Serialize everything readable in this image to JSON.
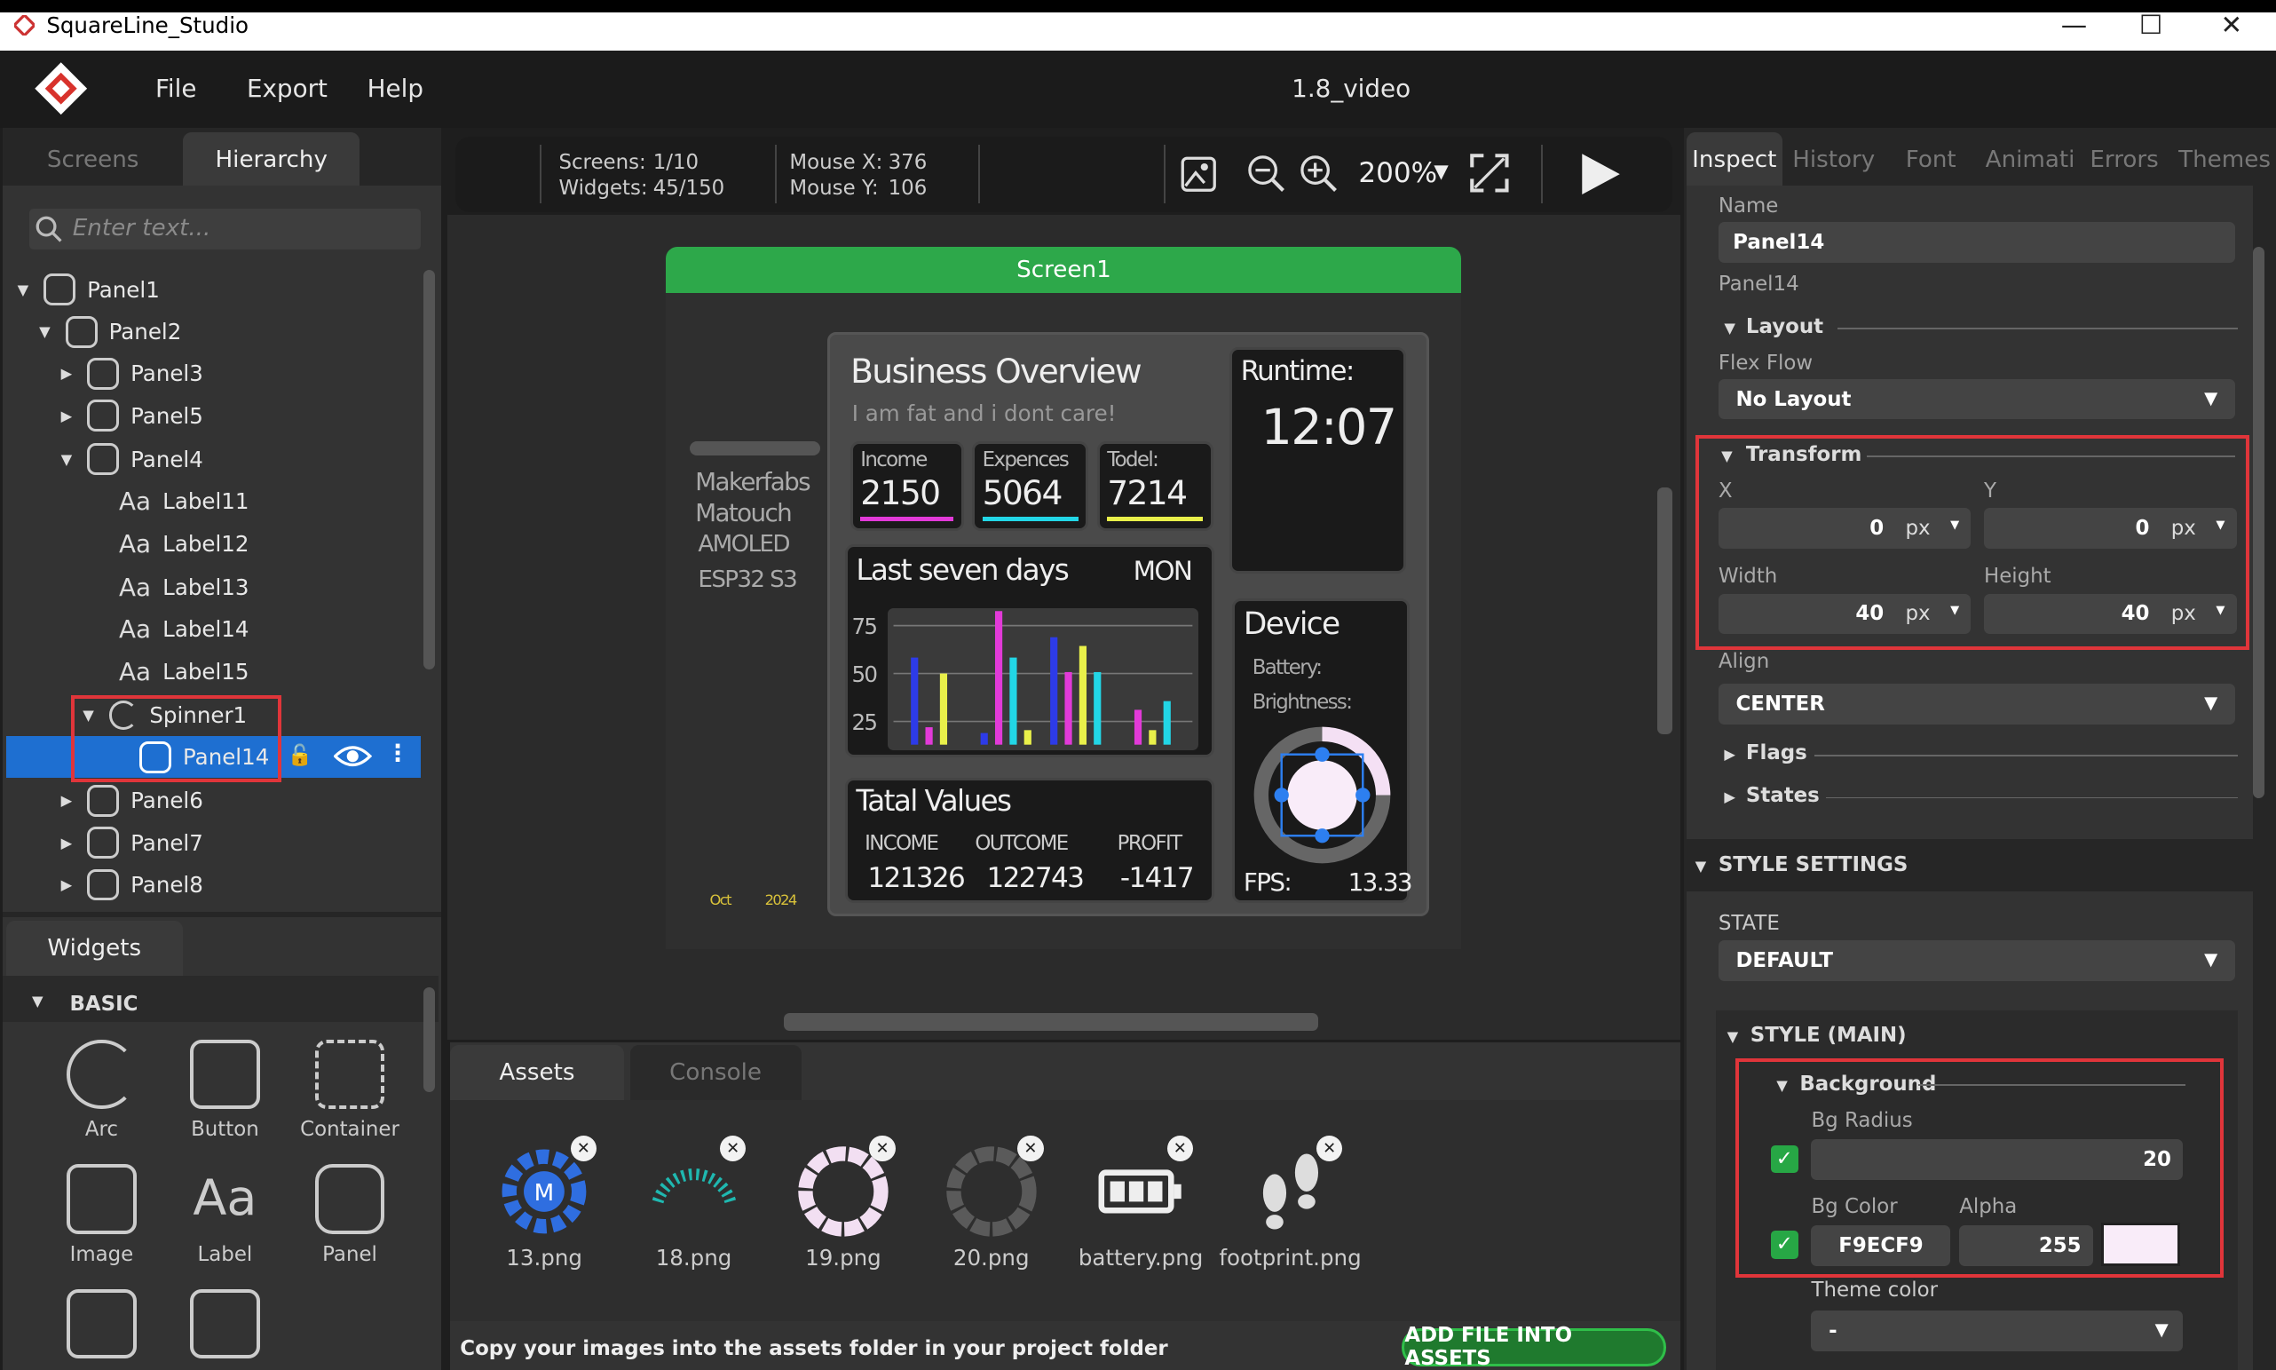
{
  "window": {
    "title": "SquareLine_Studio",
    "minimize": "—",
    "maximize": "☐",
    "close": "✕"
  },
  "menu": {
    "file": "File",
    "export": "Export",
    "help": "Help",
    "project": "1.8_video"
  },
  "left_tabs": {
    "screens": "Screens",
    "hierarchy": "Hierarchy"
  },
  "search": {
    "placeholder": "Enter text..."
  },
  "tree": [
    {
      "label": "Panel1"
    },
    {
      "label": "Panel2"
    },
    {
      "label": "Panel3"
    },
    {
      "label": "Panel5"
    },
    {
      "label": "Panel4"
    },
    {
      "label": "Label11"
    },
    {
      "label": "Label12"
    },
    {
      "label": "Label13"
    },
    {
      "label": "Label14"
    },
    {
      "label": "Label15"
    },
    {
      "label": "Spinner1"
    },
    {
      "label": "Panel14"
    },
    {
      "label": "Panel6"
    },
    {
      "label": "Panel7"
    },
    {
      "label": "Panel8"
    }
  ],
  "widgets": {
    "tab": "Widgets",
    "section": "BASIC",
    "items": [
      "Arc",
      "Button",
      "Container",
      "Image",
      "Label",
      "Panel"
    ]
  },
  "toolbar": {
    "screens_label": "Screens:",
    "screens_val": "1/10",
    "widgets_label": "Widgets:",
    "widgets_val": "45/150",
    "mousex_label": "Mouse X:",
    "mousex_val": "376",
    "mousey_label": "Mouse Y:",
    "mousey_val": "106",
    "zoom": "200%"
  },
  "screen": {
    "title": "Screen1"
  },
  "dashboard": {
    "side1": "Makerfabs",
    "side2": "Matouch",
    "side3": "AMOLED",
    "side4": "ESP32 S3",
    "month": "Oct",
    "year": "2024",
    "title": "Business Overview",
    "subtitle": "I  am  fat  and  i  dont  care!",
    "income_l": "Income",
    "income_v": "2150",
    "exp_l": "Expences",
    "exp_v": "5064",
    "todel_l": "Todel:",
    "todel_v": "7214",
    "runtime_l": "Runtime:",
    "runtime_v": "12:07",
    "last7": "Last seven days",
    "day": "MON",
    "y75": "75",
    "y50": "50",
    "y25": "25",
    "device": "Device",
    "battery": "Battery:",
    "brightness": "Brightness:",
    "total": "Tatal Values",
    "inc_h": "INCOME",
    "out_h": "OUTCOME",
    "prof_h": "PROFIT",
    "inc_v": "121326",
    "out_v": "122743",
    "prof_v": "-1417",
    "fps_l": "FPS:",
    "fps_v": "13.33"
  },
  "bottom_tabs": {
    "assets": "Assets",
    "console": "Console"
  },
  "assets": [
    {
      "name": "13.png"
    },
    {
      "name": "18.png"
    },
    {
      "name": "19.png"
    },
    {
      "name": "20.png"
    },
    {
      "name": "battery.png"
    },
    {
      "name": "footprint.png"
    }
  ],
  "assets_footer": {
    "hint": "Copy your images into the assets folder in your project folder",
    "add_button": "ADD FILE INTO ASSETS"
  },
  "right_tabs": {
    "inspect": "Inspect",
    "history": "History",
    "font": "Font",
    "animati": "Animati",
    "errors": "Errors",
    "themes": "Themes"
  },
  "inspect": {
    "name_label": "Name",
    "name_val": "Panel14",
    "type": "Panel14",
    "layout": "Layout",
    "flexflow_label": "Flex Flow",
    "flexflow_val": "No Layout",
    "transform": "Transform",
    "x_label": "X",
    "x_val": "0",
    "y_label": "Y",
    "y_val": "0",
    "w_label": "Width",
    "w_val": "40",
    "h_label": "Height",
    "h_val": "40",
    "unit": "px",
    "align_label": "Align",
    "align_val": "CENTER",
    "flags": "Flags",
    "states": "States"
  },
  "style": {
    "settings": "STYLE SETTINGS",
    "state_label": "STATE",
    "state_val": "DEFAULT",
    "main": "STYLE (MAIN)",
    "background": "Background",
    "radius_label": "Bg Radius",
    "radius_val": "20",
    "color_label": "Bg Color",
    "alpha_label": "Alpha",
    "color_val": "F9ECF9",
    "alpha_val": "255",
    "theme_label": "Theme color",
    "theme_val": "-",
    "swatch": "#F9ECF9"
  },
  "chart_colors": {
    "blue": "#2d3be8",
    "magenta": "#e23ad8",
    "cyan": "#22d6e6",
    "yellow": "#e9f04a"
  }
}
